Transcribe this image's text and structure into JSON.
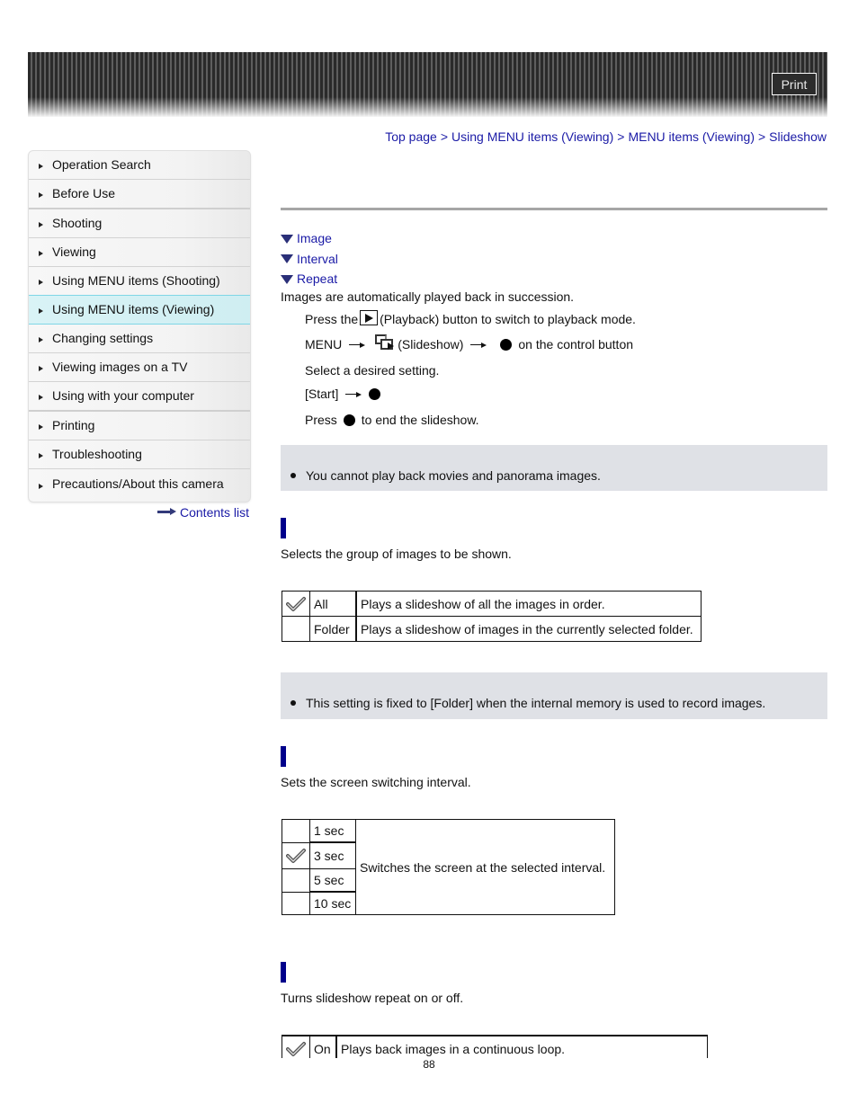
{
  "header": {
    "print_label": "Print"
  },
  "sidebar": {
    "items": [
      {
        "label": "Operation Search"
      },
      {
        "label": "Before Use"
      },
      {
        "label": "Shooting"
      },
      {
        "label": "Viewing"
      },
      {
        "label": "Using MENU items (Shooting)"
      },
      {
        "label": "Using MENU items (Viewing)",
        "active": true
      },
      {
        "label": "Changing settings"
      },
      {
        "label": "Viewing images on a TV"
      },
      {
        "label": "Using with your computer"
      },
      {
        "label": "Printing"
      },
      {
        "label": "Troubleshooting"
      },
      {
        "label": "Precautions/About this camera"
      }
    ],
    "contents_link": "Contents list"
  },
  "breadcrumb": {
    "items": [
      "Top page",
      "Using MENU items (Viewing)",
      "MENU items (Viewing)",
      "Slideshow"
    ],
    "separator": ">"
  },
  "anchors": [
    "Image",
    "Interval",
    "Repeat"
  ],
  "intro": "Images are automatically played back in succession.",
  "steps": {
    "s1_pre": "Press the",
    "s1_post": "(Playback) button to switch to playback mode.",
    "s2_menu": "MENU",
    "s2_slideshow": "(Slideshow)",
    "s2_post": "on the control button",
    "s3": "Select a desired setting.",
    "s4_pre": "[Start]",
    "s5_pre": "Press",
    "s5_post": "to end the slideshow."
  },
  "note1": "You cannot play back movies and panorama images.",
  "image_section": {
    "description": "Selects the group of images to be shown.",
    "options": [
      {
        "selected": true,
        "name": "All",
        "desc": "Plays a slideshow of all the images in order."
      },
      {
        "selected": false,
        "name": "Folder",
        "desc": "Plays a slideshow of images in the currently selected folder."
      }
    ],
    "note": "This setting is fixed to [Folder] when the internal memory is used to record images."
  },
  "interval_section": {
    "description": "Sets the screen switching interval.",
    "options": [
      {
        "selected": false,
        "name": "1 sec"
      },
      {
        "selected": true,
        "name": "3 sec"
      },
      {
        "selected": false,
        "name": "5 sec"
      },
      {
        "selected": false,
        "name": "10 sec"
      }
    ],
    "shared_desc": "Switches the screen at the selected interval."
  },
  "repeat_section": {
    "description": "Turns slideshow repeat on or off.",
    "options": [
      {
        "selected": true,
        "name": "On",
        "desc": "Plays back images in a continuous loop."
      }
    ]
  },
  "page_number": "88",
  "colors": {
    "link": "#1a1aa6",
    "section_bar": "#00008b",
    "note_bg": "#dfe1e6",
    "active_nav": "#d9f3f6"
  }
}
